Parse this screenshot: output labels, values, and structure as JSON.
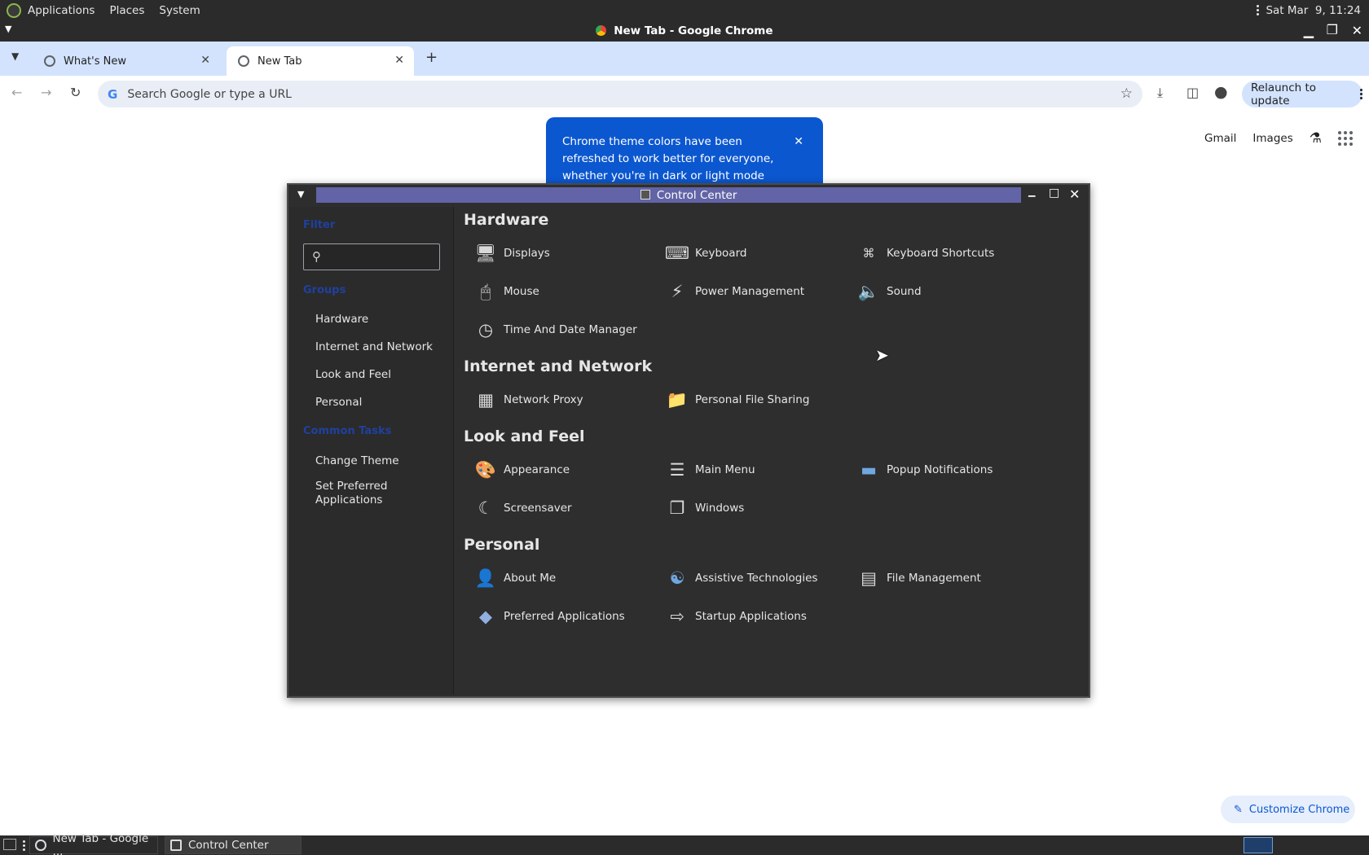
{
  "top_panel": {
    "menus": [
      "Applications",
      "Places",
      "System"
    ],
    "clock": "Sat Mar  9, 11:24"
  },
  "chrome": {
    "window_title": "New Tab - Google Chrome",
    "tabs": [
      {
        "label": "What's New"
      },
      {
        "label": "New Tab"
      }
    ],
    "omnibox_placeholder": "Search Google or type a URL",
    "relaunch_label": "Relaunch to update",
    "ntp": {
      "gmail": "Gmail",
      "images": "Images",
      "customize": "Customize Chrome"
    },
    "theme_bubble": "Chrome theme colors have been refreshed to work better for everyone, whether you're in dark or light mode"
  },
  "control_center": {
    "title": "Control Center",
    "sidebar": {
      "filter_header": "Filter",
      "groups_header": "Groups",
      "groups": [
        "Hardware",
        "Internet and Network",
        "Look and Feel",
        "Personal"
      ],
      "tasks_header": "Common Tasks",
      "tasks": [
        "Change Theme",
        "Set Preferred Applications"
      ]
    },
    "groups": [
      {
        "title": "Hardware",
        "items": [
          {
            "label": "Displays",
            "icon": "monitor-icon"
          },
          {
            "label": "Keyboard",
            "icon": "keyboard-icon"
          },
          {
            "label": "Keyboard Shortcuts",
            "icon": "keyboard-shortcuts-icon"
          },
          {
            "label": "Mouse",
            "icon": "mouse-icon"
          },
          {
            "label": "Power Management",
            "icon": "power-icon"
          },
          {
            "label": "Sound",
            "icon": "speaker-icon"
          },
          {
            "label": "Time And Date Manager",
            "icon": "clock-icon"
          }
        ]
      },
      {
        "title": "Internet and Network",
        "items": [
          {
            "label": "Network Proxy",
            "icon": "network-proxy-icon"
          },
          {
            "label": "Personal File Sharing",
            "icon": "folder-share-icon"
          }
        ]
      },
      {
        "title": "Look and Feel",
        "items": [
          {
            "label": "Appearance",
            "icon": "appearance-icon"
          },
          {
            "label": "Main Menu",
            "icon": "menu-icon"
          },
          {
            "label": "Popup Notifications",
            "icon": "notification-icon"
          },
          {
            "label": "Screensaver",
            "icon": "screensaver-icon"
          },
          {
            "label": "Windows",
            "icon": "windows-icon"
          }
        ]
      },
      {
        "title": "Personal",
        "items": [
          {
            "label": "About Me",
            "icon": "user-icon"
          },
          {
            "label": "Assistive Technologies",
            "icon": "accessibility-icon"
          },
          {
            "label": "File Management",
            "icon": "file-cabinet-icon"
          },
          {
            "label": "Preferred Applications",
            "icon": "preferred-apps-icon"
          },
          {
            "label": "Startup Applications",
            "icon": "startup-icon"
          }
        ]
      }
    ]
  },
  "taskbar": {
    "items": [
      "New Tab - Google ...",
      "Control Center"
    ]
  }
}
